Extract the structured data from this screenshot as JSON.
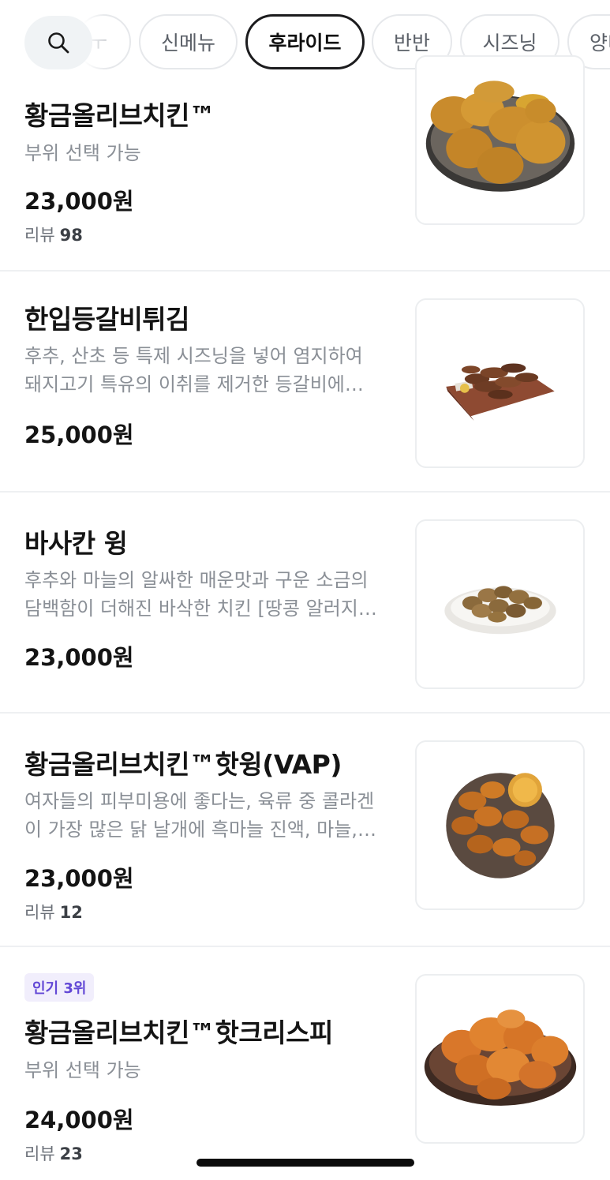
{
  "search": {
    "icon": "search-icon"
  },
  "categories": {
    "partial_label": "ㅜ",
    "items": [
      {
        "label": "신메뉴",
        "active": false
      },
      {
        "label": "후라이드",
        "active": true
      },
      {
        "label": "반반",
        "active": false
      },
      {
        "label": "시즈닝",
        "active": false
      },
      {
        "label": "양녀",
        "active": false
      }
    ]
  },
  "menu": [
    {
      "name": "황금올리브치킨™",
      "description": [
        "부위 선택 가능"
      ],
      "price": "23,000원",
      "review_label": "리뷰",
      "review_count": "98",
      "image": "fried-chicken-platter"
    },
    {
      "name": "한입등갈비튀김",
      "description": [
        "후추, 산초 등 특제 시즈닝을 넣어 염지하여",
        "돼지고기 특유의 이취를 제거한 등갈비에…"
      ],
      "price": "25,000원",
      "image": "fried-ribs-board"
    },
    {
      "name": "바사칸 윙",
      "description": [
        "후추와 마늘의 알싸한 매운맛과 구운 소금의",
        "담백함이 더해진 바삭한 치킨 [땅콩 알러지…"
      ],
      "price": "23,000원",
      "image": "wings-plate"
    },
    {
      "name": "황금올리브치킨™핫윙(VAP)",
      "description": [
        "여자들의 피부미용에 좋다는, 육류 중 콜라겐",
        "이 가장 많은 닭 날개에 흑마늘 진액, 마늘,…"
      ],
      "price": "23,000원",
      "review_label": "리뷰",
      "review_count": "12",
      "image": "hot-wings-plate"
    },
    {
      "badge": "인기 3위",
      "name": "황금올리브치킨™핫크리스피",
      "description": [
        "부위 선택 가능"
      ],
      "price": "24,000원",
      "review_label": "리뷰",
      "review_count": "23",
      "image": "hot-crispy-chicken"
    }
  ]
}
